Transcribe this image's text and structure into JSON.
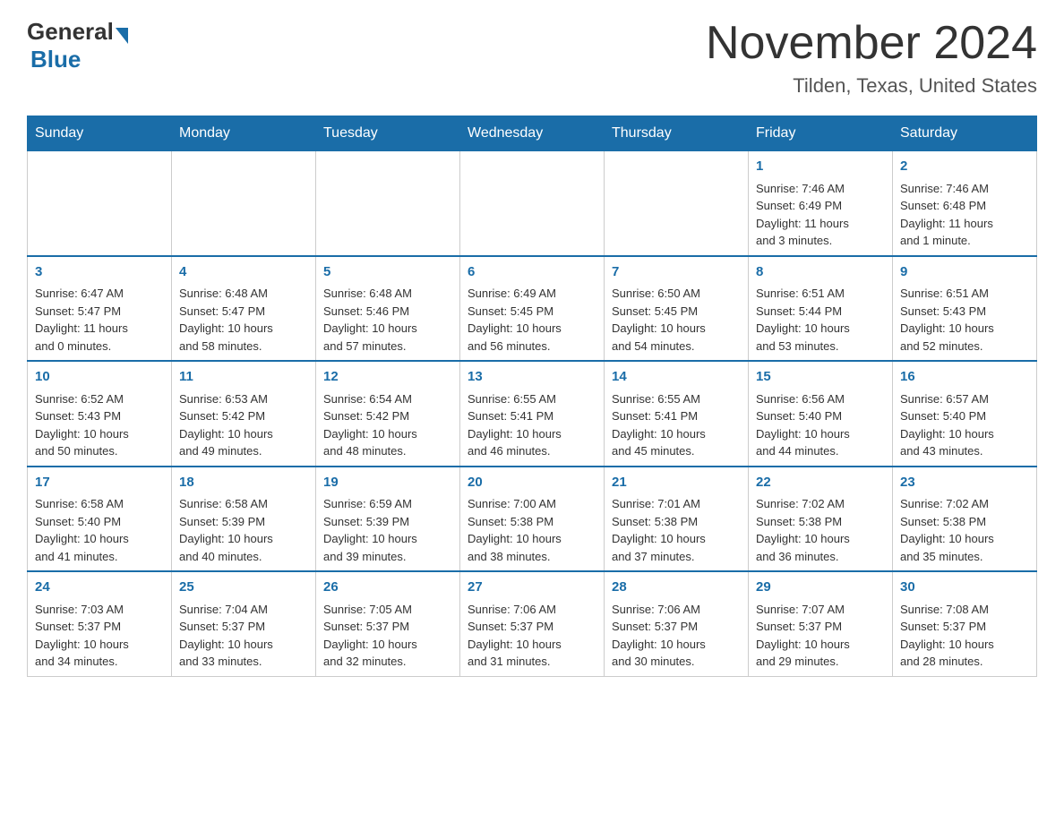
{
  "header": {
    "logo_general": "General",
    "logo_blue": "Blue",
    "month_title": "November 2024",
    "location": "Tilden, Texas, United States"
  },
  "weekdays": [
    "Sunday",
    "Monday",
    "Tuesday",
    "Wednesday",
    "Thursday",
    "Friday",
    "Saturday"
  ],
  "weeks": [
    [
      {
        "day": "",
        "info": ""
      },
      {
        "day": "",
        "info": ""
      },
      {
        "day": "",
        "info": ""
      },
      {
        "day": "",
        "info": ""
      },
      {
        "day": "",
        "info": ""
      },
      {
        "day": "1",
        "info": "Sunrise: 7:46 AM\nSunset: 6:49 PM\nDaylight: 11 hours\nand 3 minutes."
      },
      {
        "day": "2",
        "info": "Sunrise: 7:46 AM\nSunset: 6:48 PM\nDaylight: 11 hours\nand 1 minute."
      }
    ],
    [
      {
        "day": "3",
        "info": "Sunrise: 6:47 AM\nSunset: 5:47 PM\nDaylight: 11 hours\nand 0 minutes."
      },
      {
        "day": "4",
        "info": "Sunrise: 6:48 AM\nSunset: 5:47 PM\nDaylight: 10 hours\nand 58 minutes."
      },
      {
        "day": "5",
        "info": "Sunrise: 6:48 AM\nSunset: 5:46 PM\nDaylight: 10 hours\nand 57 minutes."
      },
      {
        "day": "6",
        "info": "Sunrise: 6:49 AM\nSunset: 5:45 PM\nDaylight: 10 hours\nand 56 minutes."
      },
      {
        "day": "7",
        "info": "Sunrise: 6:50 AM\nSunset: 5:45 PM\nDaylight: 10 hours\nand 54 minutes."
      },
      {
        "day": "8",
        "info": "Sunrise: 6:51 AM\nSunset: 5:44 PM\nDaylight: 10 hours\nand 53 minutes."
      },
      {
        "day": "9",
        "info": "Sunrise: 6:51 AM\nSunset: 5:43 PM\nDaylight: 10 hours\nand 52 minutes."
      }
    ],
    [
      {
        "day": "10",
        "info": "Sunrise: 6:52 AM\nSunset: 5:43 PM\nDaylight: 10 hours\nand 50 minutes."
      },
      {
        "day": "11",
        "info": "Sunrise: 6:53 AM\nSunset: 5:42 PM\nDaylight: 10 hours\nand 49 minutes."
      },
      {
        "day": "12",
        "info": "Sunrise: 6:54 AM\nSunset: 5:42 PM\nDaylight: 10 hours\nand 48 minutes."
      },
      {
        "day": "13",
        "info": "Sunrise: 6:55 AM\nSunset: 5:41 PM\nDaylight: 10 hours\nand 46 minutes."
      },
      {
        "day": "14",
        "info": "Sunrise: 6:55 AM\nSunset: 5:41 PM\nDaylight: 10 hours\nand 45 minutes."
      },
      {
        "day": "15",
        "info": "Sunrise: 6:56 AM\nSunset: 5:40 PM\nDaylight: 10 hours\nand 44 minutes."
      },
      {
        "day": "16",
        "info": "Sunrise: 6:57 AM\nSunset: 5:40 PM\nDaylight: 10 hours\nand 43 minutes."
      }
    ],
    [
      {
        "day": "17",
        "info": "Sunrise: 6:58 AM\nSunset: 5:40 PM\nDaylight: 10 hours\nand 41 minutes."
      },
      {
        "day": "18",
        "info": "Sunrise: 6:58 AM\nSunset: 5:39 PM\nDaylight: 10 hours\nand 40 minutes."
      },
      {
        "day": "19",
        "info": "Sunrise: 6:59 AM\nSunset: 5:39 PM\nDaylight: 10 hours\nand 39 minutes."
      },
      {
        "day": "20",
        "info": "Sunrise: 7:00 AM\nSunset: 5:38 PM\nDaylight: 10 hours\nand 38 minutes."
      },
      {
        "day": "21",
        "info": "Sunrise: 7:01 AM\nSunset: 5:38 PM\nDaylight: 10 hours\nand 37 minutes."
      },
      {
        "day": "22",
        "info": "Sunrise: 7:02 AM\nSunset: 5:38 PM\nDaylight: 10 hours\nand 36 minutes."
      },
      {
        "day": "23",
        "info": "Sunrise: 7:02 AM\nSunset: 5:38 PM\nDaylight: 10 hours\nand 35 minutes."
      }
    ],
    [
      {
        "day": "24",
        "info": "Sunrise: 7:03 AM\nSunset: 5:37 PM\nDaylight: 10 hours\nand 34 minutes."
      },
      {
        "day": "25",
        "info": "Sunrise: 7:04 AM\nSunset: 5:37 PM\nDaylight: 10 hours\nand 33 minutes."
      },
      {
        "day": "26",
        "info": "Sunrise: 7:05 AM\nSunset: 5:37 PM\nDaylight: 10 hours\nand 32 minutes."
      },
      {
        "day": "27",
        "info": "Sunrise: 7:06 AM\nSunset: 5:37 PM\nDaylight: 10 hours\nand 31 minutes."
      },
      {
        "day": "28",
        "info": "Sunrise: 7:06 AM\nSunset: 5:37 PM\nDaylight: 10 hours\nand 30 minutes."
      },
      {
        "day": "29",
        "info": "Sunrise: 7:07 AM\nSunset: 5:37 PM\nDaylight: 10 hours\nand 29 minutes."
      },
      {
        "day": "30",
        "info": "Sunrise: 7:08 AM\nSunset: 5:37 PM\nDaylight: 10 hours\nand 28 minutes."
      }
    ]
  ]
}
